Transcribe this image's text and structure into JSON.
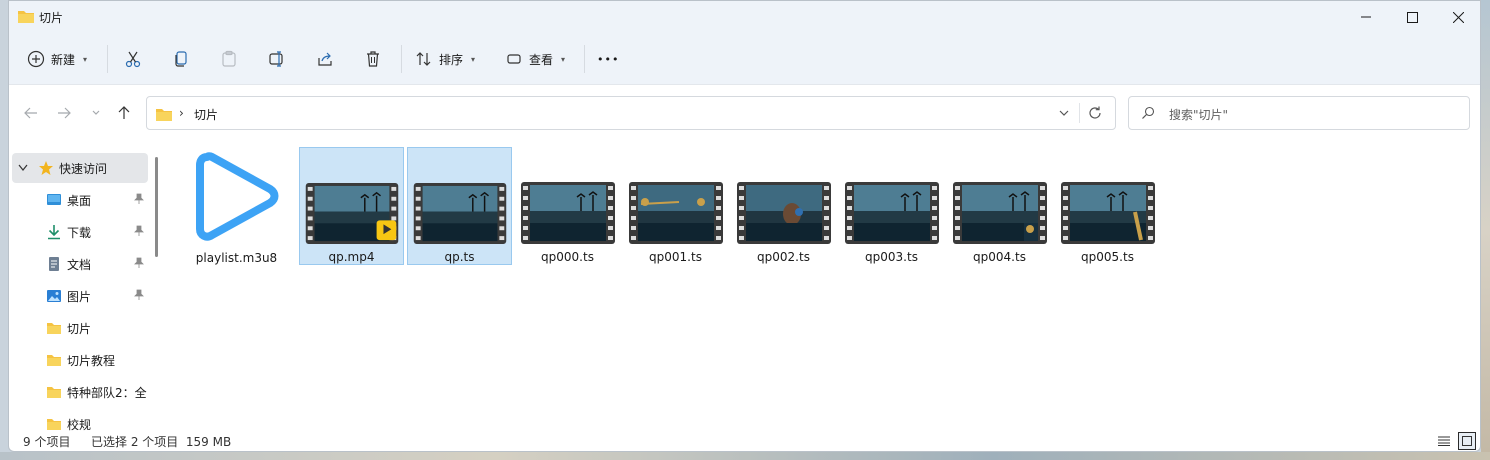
{
  "window": {
    "title": "切片"
  },
  "toolbar": {
    "new_label": "新建",
    "sort_label": "排序",
    "view_label": "查看",
    "more_label": "•••"
  },
  "nav": {
    "separator": "›",
    "crumb": "切片",
    "search_placeholder": "搜索\"切片\""
  },
  "sidebar": {
    "items": [
      {
        "label": "快速访问",
        "icon": "star-icon"
      },
      {
        "label": "桌面",
        "icon": "desktop-icon"
      },
      {
        "label": "下载",
        "icon": "download-icon"
      },
      {
        "label": "文档",
        "icon": "document-icon"
      },
      {
        "label": "图片",
        "icon": "pictures-icon"
      },
      {
        "label": "切片",
        "icon": "folder-icon"
      },
      {
        "label": "切片教程",
        "icon": "folder-icon"
      },
      {
        "label": "特种部队2：全",
        "icon": "folder-icon"
      },
      {
        "label": "校规",
        "icon": "folder-icon"
      }
    ]
  },
  "files": [
    {
      "name": "playlist.m3u8",
      "selected": false
    },
    {
      "name": "qp.mp4",
      "selected": true
    },
    {
      "name": "qp.ts",
      "selected": true
    },
    {
      "name": "qp000.ts",
      "selected": false
    },
    {
      "name": "qp001.ts",
      "selected": false
    },
    {
      "name": "qp002.ts",
      "selected": false
    },
    {
      "name": "qp003.ts",
      "selected": false
    },
    {
      "name": "qp004.ts",
      "selected": false
    },
    {
      "name": "qp005.ts",
      "selected": false
    }
  ],
  "player_badge": "Player",
  "status": {
    "count": "9 个项目",
    "selection": "已选择 2 个项目  159 MB"
  },
  "colors": {
    "accent": "#3da3f5",
    "folder": "#f5c342",
    "selection_bg": "#cce4f7"
  }
}
